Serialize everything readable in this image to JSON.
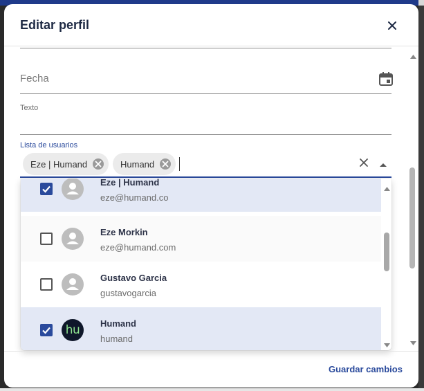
{
  "dialog": {
    "title": "Editar perfil",
    "save_label": "Guardar cambios"
  },
  "fields": {
    "date_label": "Fecha",
    "text_label": "Texto",
    "users_label": "Lista de usuarios"
  },
  "chips": [
    {
      "label": "Eze | Humand"
    },
    {
      "label": "Humand"
    }
  ],
  "options": [
    {
      "name": "Eze | Humand",
      "subtitle": "eze@humand.co",
      "checked": true,
      "avatar": "person-icon"
    },
    {
      "name": "Eze Morkin",
      "subtitle": "eze@humand.com",
      "checked": false,
      "avatar": "person-icon"
    },
    {
      "name": "Gustavo Garcia",
      "subtitle": "gustavogarcia",
      "checked": false,
      "avatar": "person-icon"
    },
    {
      "name": "Humand",
      "subtitle": "humand",
      "checked": true,
      "avatar": "brand-logo",
      "avatar_text": "hu"
    }
  ],
  "colors": {
    "accent": "#2a4a9c",
    "selected_row": "#e3e8f5",
    "title_text": "#1e2a44"
  }
}
